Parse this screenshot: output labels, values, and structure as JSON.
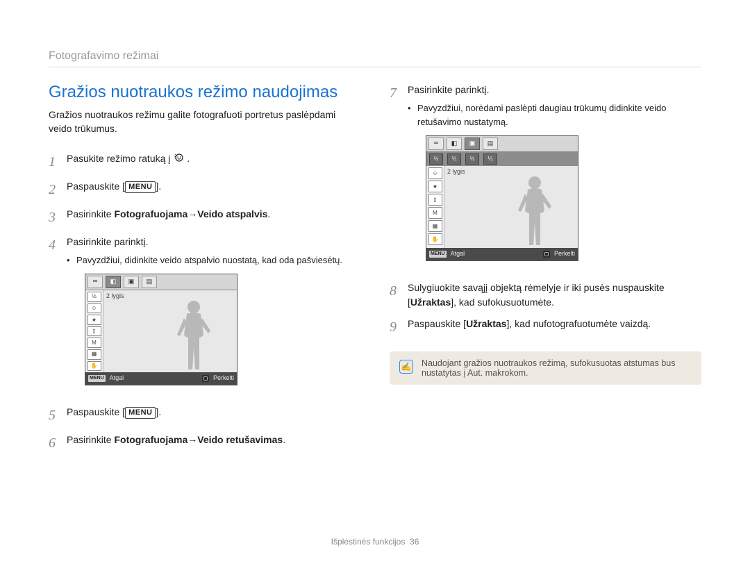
{
  "breadcrumb": "Fotografavimo režimai",
  "section_title": "Gražios nuotraukos režimo naudojimas",
  "intro": "Gražios nuotraukos režimu galite fotografuoti portretus paslėpdami veido trūkumus.",
  "left_steps": {
    "s1": {
      "num": "1",
      "prefix": "Pasukite režimo ratuką į ",
      "suffix": "."
    },
    "s2": {
      "num": "2",
      "prefix": "Paspauskite [",
      "menu": "MENU",
      "suffix": "]."
    },
    "s3": {
      "num": "3",
      "prefix": "Pasirinkite ",
      "b1": "Fotografuojama",
      "arrow": " → ",
      "b2": "Veido atspalvis",
      "suffix": "."
    },
    "s4": {
      "num": "4",
      "text": "Pasirinkite parinktį.",
      "sub": "Pavyzdžiui, didinkite veido atspalvio nuostatą, kad oda pašviesėtų."
    },
    "s5": {
      "num": "5",
      "prefix": "Paspauskite [",
      "menu": "MENU",
      "suffix": "]."
    },
    "s6": {
      "num": "6",
      "prefix": "Pasirinkite ",
      "b1": "Fotografuojama",
      "arrow": " → ",
      "b2": "Veido retušavimas",
      "suffix": "."
    }
  },
  "right_steps": {
    "s7": {
      "num": "7",
      "text": "Pasirinkite parinktį.",
      "sub": "Pavyzdžiui, norėdami paslėpti daugiau trūkumų didinkite veido retušavimo nustatymą."
    },
    "s8": {
      "num": "8",
      "prefix": "Sulygiuokite savąjį objektą rėmelyje ir iki pusės nuspauskite [",
      "b1": "Užraktas",
      "suffix": "], kad sufokusuotumėte."
    },
    "s9": {
      "num": "9",
      "prefix": "Paspauskite [",
      "b1": "Užraktas",
      "suffix": "], kad nufotografuotumėte vaizdą."
    }
  },
  "lcd": {
    "level_label": "2 lygis",
    "footer_back": "Atgal",
    "footer_move": "Perkelti",
    "footer_menu": "MENU",
    "top_cells": [
      "⮹",
      "◧",
      "▣",
      "▤"
    ],
    "face_cells": [
      "½",
      "⅟₁",
      "½",
      "⅟₃"
    ],
    "side_icons": [
      "☺",
      "★",
      "▯",
      "M",
      "▦",
      "✋"
    ],
    "top_cells_b": [
      "½",
      "⅟₁",
      "½",
      "⅟₃"
    ]
  },
  "callout": {
    "text": "Naudojant gražios nuotraukos režimą, sufokusuotas atstumas bus nustatytas į Aut. makrokom."
  },
  "footer": {
    "label": "Išplėstinės funkcijos",
    "page": "36"
  }
}
